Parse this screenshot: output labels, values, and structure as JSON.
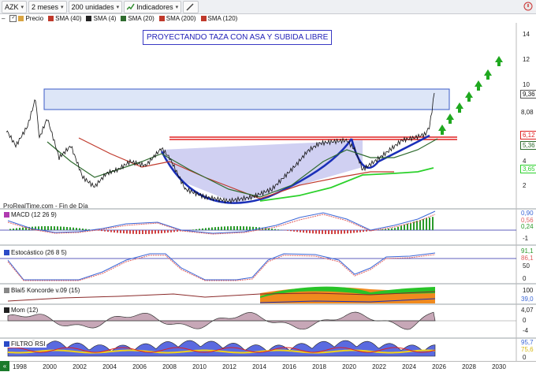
{
  "toolbar": {
    "symbol": "AZK",
    "period": "2 meses",
    "units": "200 unidades",
    "indicators": "Indicadores"
  },
  "legend": {
    "items": [
      {
        "label": "Precio",
        "color": "#d9a441"
      },
      {
        "label": "SMA (40)",
        "color": "#c0392b"
      },
      {
        "label": "SMA (4)",
        "color": "#222222"
      },
      {
        "label": "SMA (20)",
        "color": "#2f6b2f"
      },
      {
        "label": "SMA (200)",
        "color": "#c0392b"
      },
      {
        "label": "SMA (120)",
        "color": "#c0392b"
      }
    ]
  },
  "main": {
    "annotation": "PROYECTANDO TAZA CON ASA Y SUBIDA LIBRE",
    "source": "ProRealTime.com - Fin de Día",
    "y_ticks": [
      "14",
      "12",
      "10",
      "8,08",
      "6,12",
      "5,36",
      "4",
      "3,65",
      "2"
    ],
    "last_price": "9,36"
  },
  "panels": {
    "macd": {
      "label": "MACD (12 26 9)",
      "values": [
        "0,90",
        "0,56",
        "0,24",
        "-1"
      ]
    },
    "stoch": {
      "label": "Estocástico (26 8 5)",
      "values": [
        "91,1",
        "86,1",
        "50",
        "0"
      ]
    },
    "koncorde": {
      "label": "Blai5 Koncorde v.09 (15)",
      "values": [
        "100",
        "39,0"
      ]
    },
    "mom": {
      "label": "Mom (12)",
      "values": [
        "4,07",
        "0",
        "-4"
      ]
    },
    "rsi": {
      "label": "FILTRO RSI",
      "values": [
        "95,7",
        "75,6",
        "0"
      ]
    }
  },
  "xaxis": {
    "years": [
      "1998",
      "2000",
      "2002",
      "2004",
      "2006",
      "2008",
      "2010",
      "2012",
      "2014",
      "2016",
      "2018",
      "2020",
      "2022",
      "2024",
      "2026",
      "2028",
      "2030"
    ]
  },
  "colors": {
    "bg": "#ffffff",
    "handle_fill": "#c8c8f0",
    "resistance": "#e02020",
    "cup": "#1a2fb8",
    "arrows": "#1fa81f"
  }
}
